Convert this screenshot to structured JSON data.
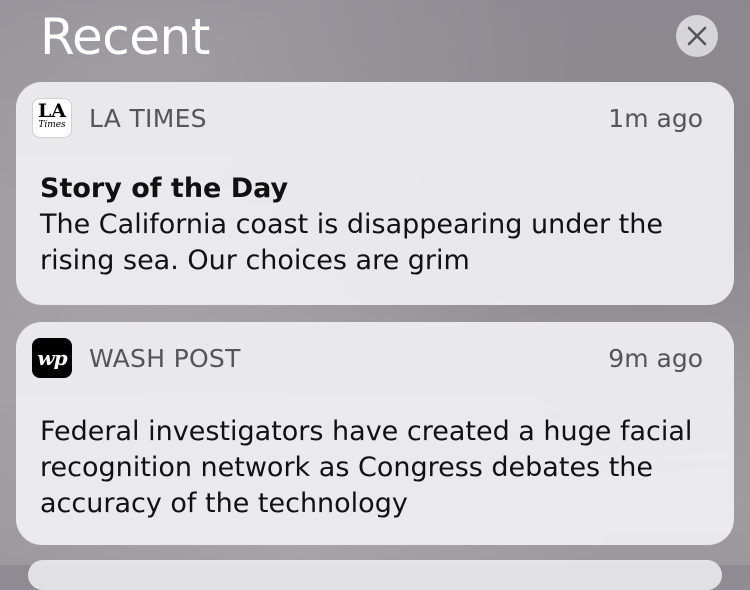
{
  "header": {
    "title": "Recent",
    "clear_icon": "close-icon"
  },
  "notifications": [
    {
      "app": "LA TIMES",
      "icon": "la-times-logo",
      "icon_text": [
        "LA",
        "Times"
      ],
      "time": "1m ago",
      "title": "Story of the Day",
      "body": "The California coast is disappearing under the rising sea. Our choices are grim"
    },
    {
      "app": "WASH POST",
      "icon": "wash-post-logo",
      "icon_text": "wp",
      "time": "9m ago",
      "title": "",
      "body": "Federal investigators have created a huge facial recognition network as Congress debates the accuracy of the technology"
    }
  ],
  "colors": {
    "header_text": "#ffffff",
    "card_bg": "#f2f2f4",
    "card_header_bg": "#e8e8eb",
    "secondary_text": "#555559",
    "primary_text": "#111111"
  }
}
